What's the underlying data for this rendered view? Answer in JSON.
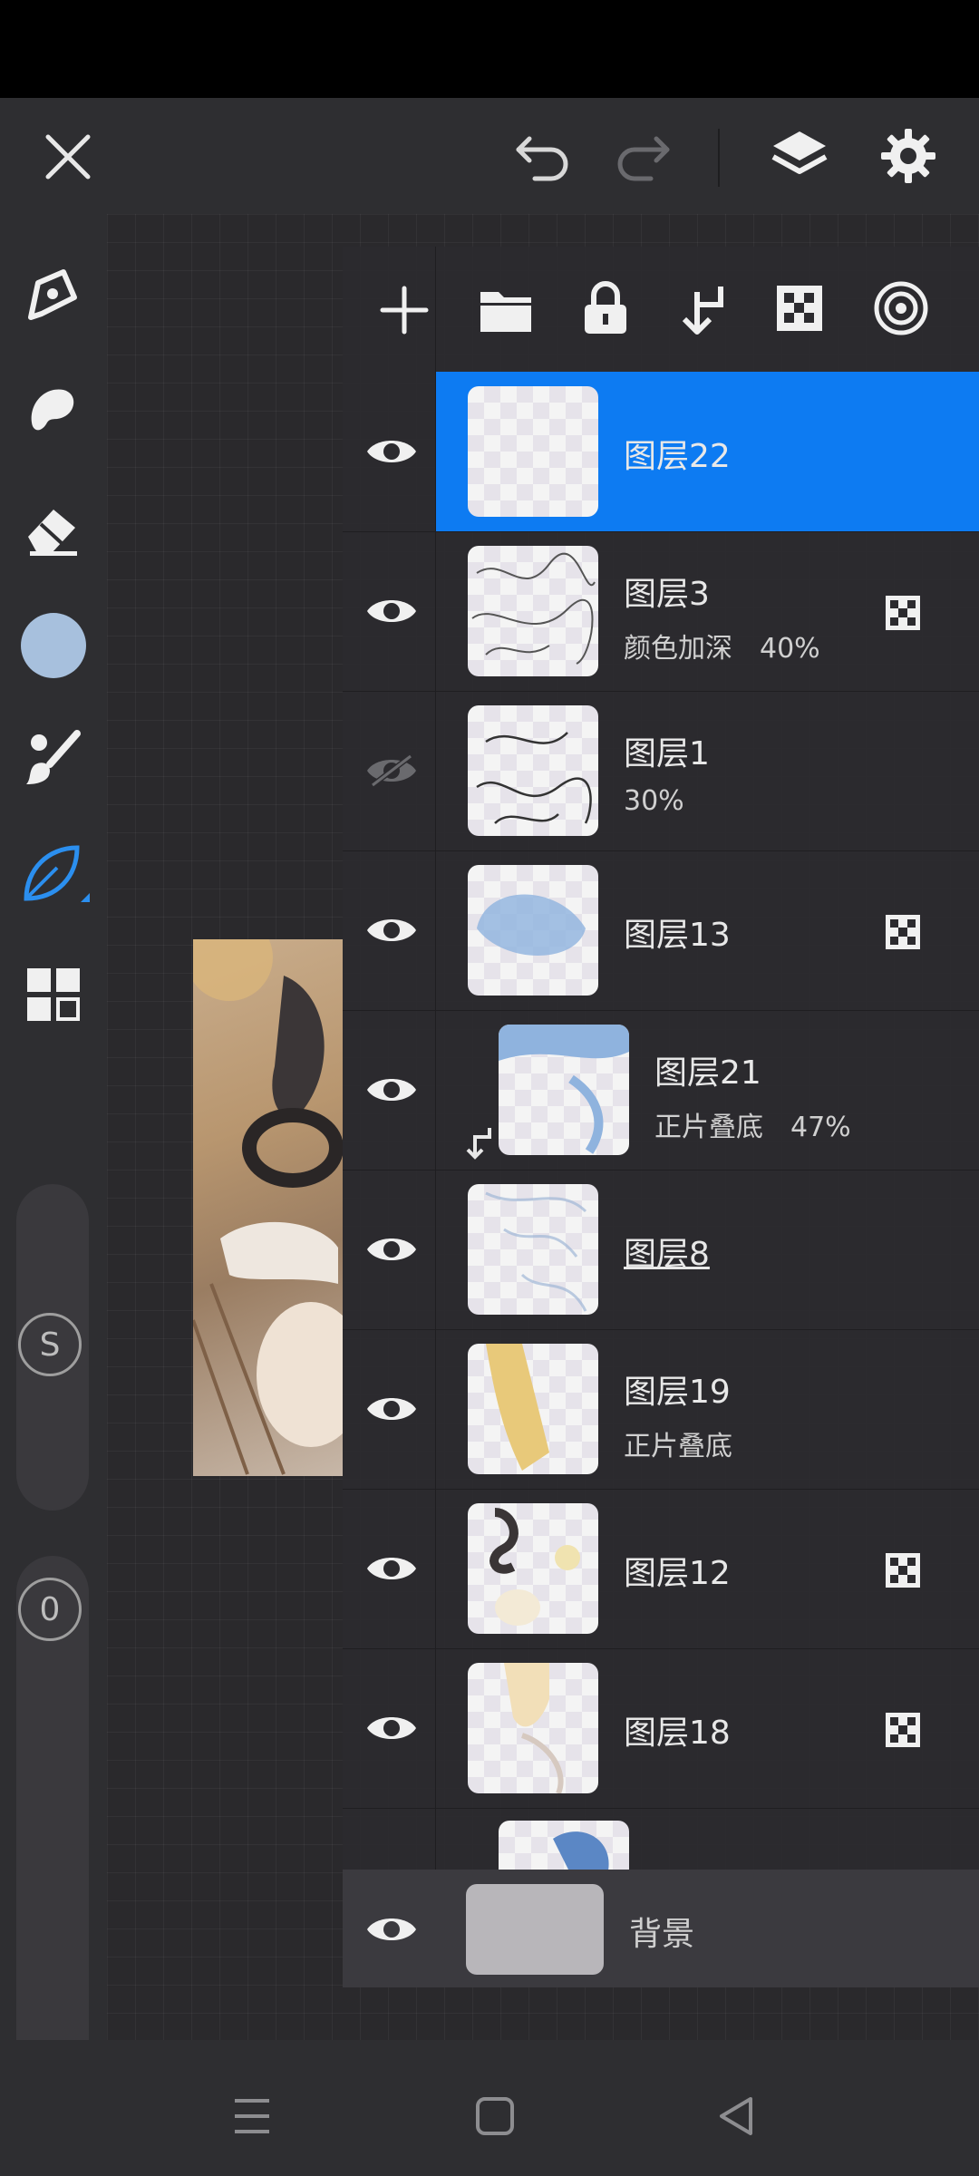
{
  "colors": {
    "accent": "#0d7bf2",
    "current_color": "#a7c0dd"
  },
  "top_bar": {
    "icons": [
      "close-icon",
      "undo-icon",
      "redo-icon",
      "layers-icon",
      "settings-icon"
    ]
  },
  "left_toolbar": {
    "tools": [
      "pen-icon",
      "smudge-icon",
      "eraser-icon",
      "color-swatch",
      "brush-icon",
      "leaf-brush-icon",
      "grid-tools-icon"
    ],
    "size_slider_label": "S",
    "opacity_slider_label": "0"
  },
  "layer_toolbar": {
    "icons": [
      "add-layer-icon",
      "folder-icon",
      "lock-icon",
      "clip-icon",
      "alpha-icon",
      "layer-properties-icon"
    ]
  },
  "layers": [
    {
      "name": "图层22",
      "sub": "",
      "visible": true,
      "selected": true,
      "alpha_lock": false,
      "clipped": false,
      "link": false
    },
    {
      "name": "图层3",
      "sub": "颜色加深　40%",
      "visible": true,
      "selected": false,
      "alpha_lock": true,
      "clipped": false,
      "link": false
    },
    {
      "name": "图层1",
      "sub": "30%",
      "visible": false,
      "selected": false,
      "alpha_lock": false,
      "clipped": false,
      "link": false
    },
    {
      "name": "图层13",
      "sub": "",
      "visible": true,
      "selected": false,
      "alpha_lock": true,
      "clipped": false,
      "link": false
    },
    {
      "name": "图层21",
      "sub": "正片叠底　47%",
      "visible": true,
      "selected": false,
      "alpha_lock": false,
      "clipped": true,
      "link": false
    },
    {
      "name": "图层8",
      "sub": "",
      "visible": true,
      "selected": false,
      "alpha_lock": false,
      "clipped": false,
      "link": true
    },
    {
      "name": "图层19",
      "sub": "正片叠底",
      "visible": true,
      "selected": false,
      "alpha_lock": false,
      "clipped": false,
      "link": false
    },
    {
      "name": "图层12",
      "sub": "",
      "visible": true,
      "selected": false,
      "alpha_lock": true,
      "clipped": false,
      "link": false
    },
    {
      "name": "图层18",
      "sub": "",
      "visible": true,
      "selected": false,
      "alpha_lock": true,
      "clipped": false,
      "link": false
    }
  ],
  "background_layer": {
    "name": "背景"
  },
  "nav_bar": {
    "icons": [
      "menu-nav-icon",
      "home-nav-icon",
      "back-nav-icon"
    ]
  }
}
